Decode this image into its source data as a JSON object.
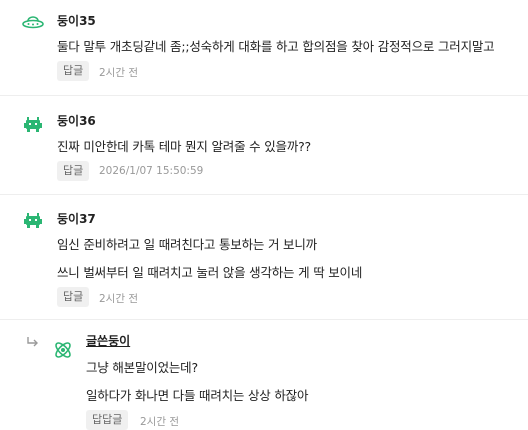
{
  "comments": [
    {
      "author": "둥이35",
      "avatar_icon": "ufo-icon",
      "lines": [
        "둘다 말투 개초딩같네 좀;;성숙하게 대화를 하고 합의점을 찾아 감정적으로 그러지말고"
      ],
      "reply_label": "답글",
      "time": "2시간 전"
    },
    {
      "author": "둥이36",
      "avatar_icon": "space-invader-icon",
      "lines": [
        "진짜 미안한데 카톡 테마 뭔지 알려줄 수 있을까??"
      ],
      "reply_label": "답글",
      "time": "2026/1/07 15:50:59"
    },
    {
      "author": "둥이37",
      "avatar_icon": "space-invader-icon",
      "lines": [
        "임신 준비하려고 일 때려친다고 통보하는 거 보니까",
        "쓰니 벌써부터 일 때려치고 눌러 앉을 생각하는 게 딱 보이네"
      ],
      "reply_label": "답글",
      "time": "2시간 전"
    },
    {
      "author": "글쓴둥이",
      "avatar_icon": "atom-icon",
      "lines": [
        "그냥 해본말이었는데?",
        "일하다가 화나면 다들 때려치는 상상 하잖아"
      ],
      "reply_label": "답답글",
      "time": "2시간 전"
    }
  ],
  "colors": {
    "avatar_green": "#2bb673",
    "divider": "#eeeeee",
    "button_bg": "#f0f0f0",
    "time_text": "#999999"
  }
}
